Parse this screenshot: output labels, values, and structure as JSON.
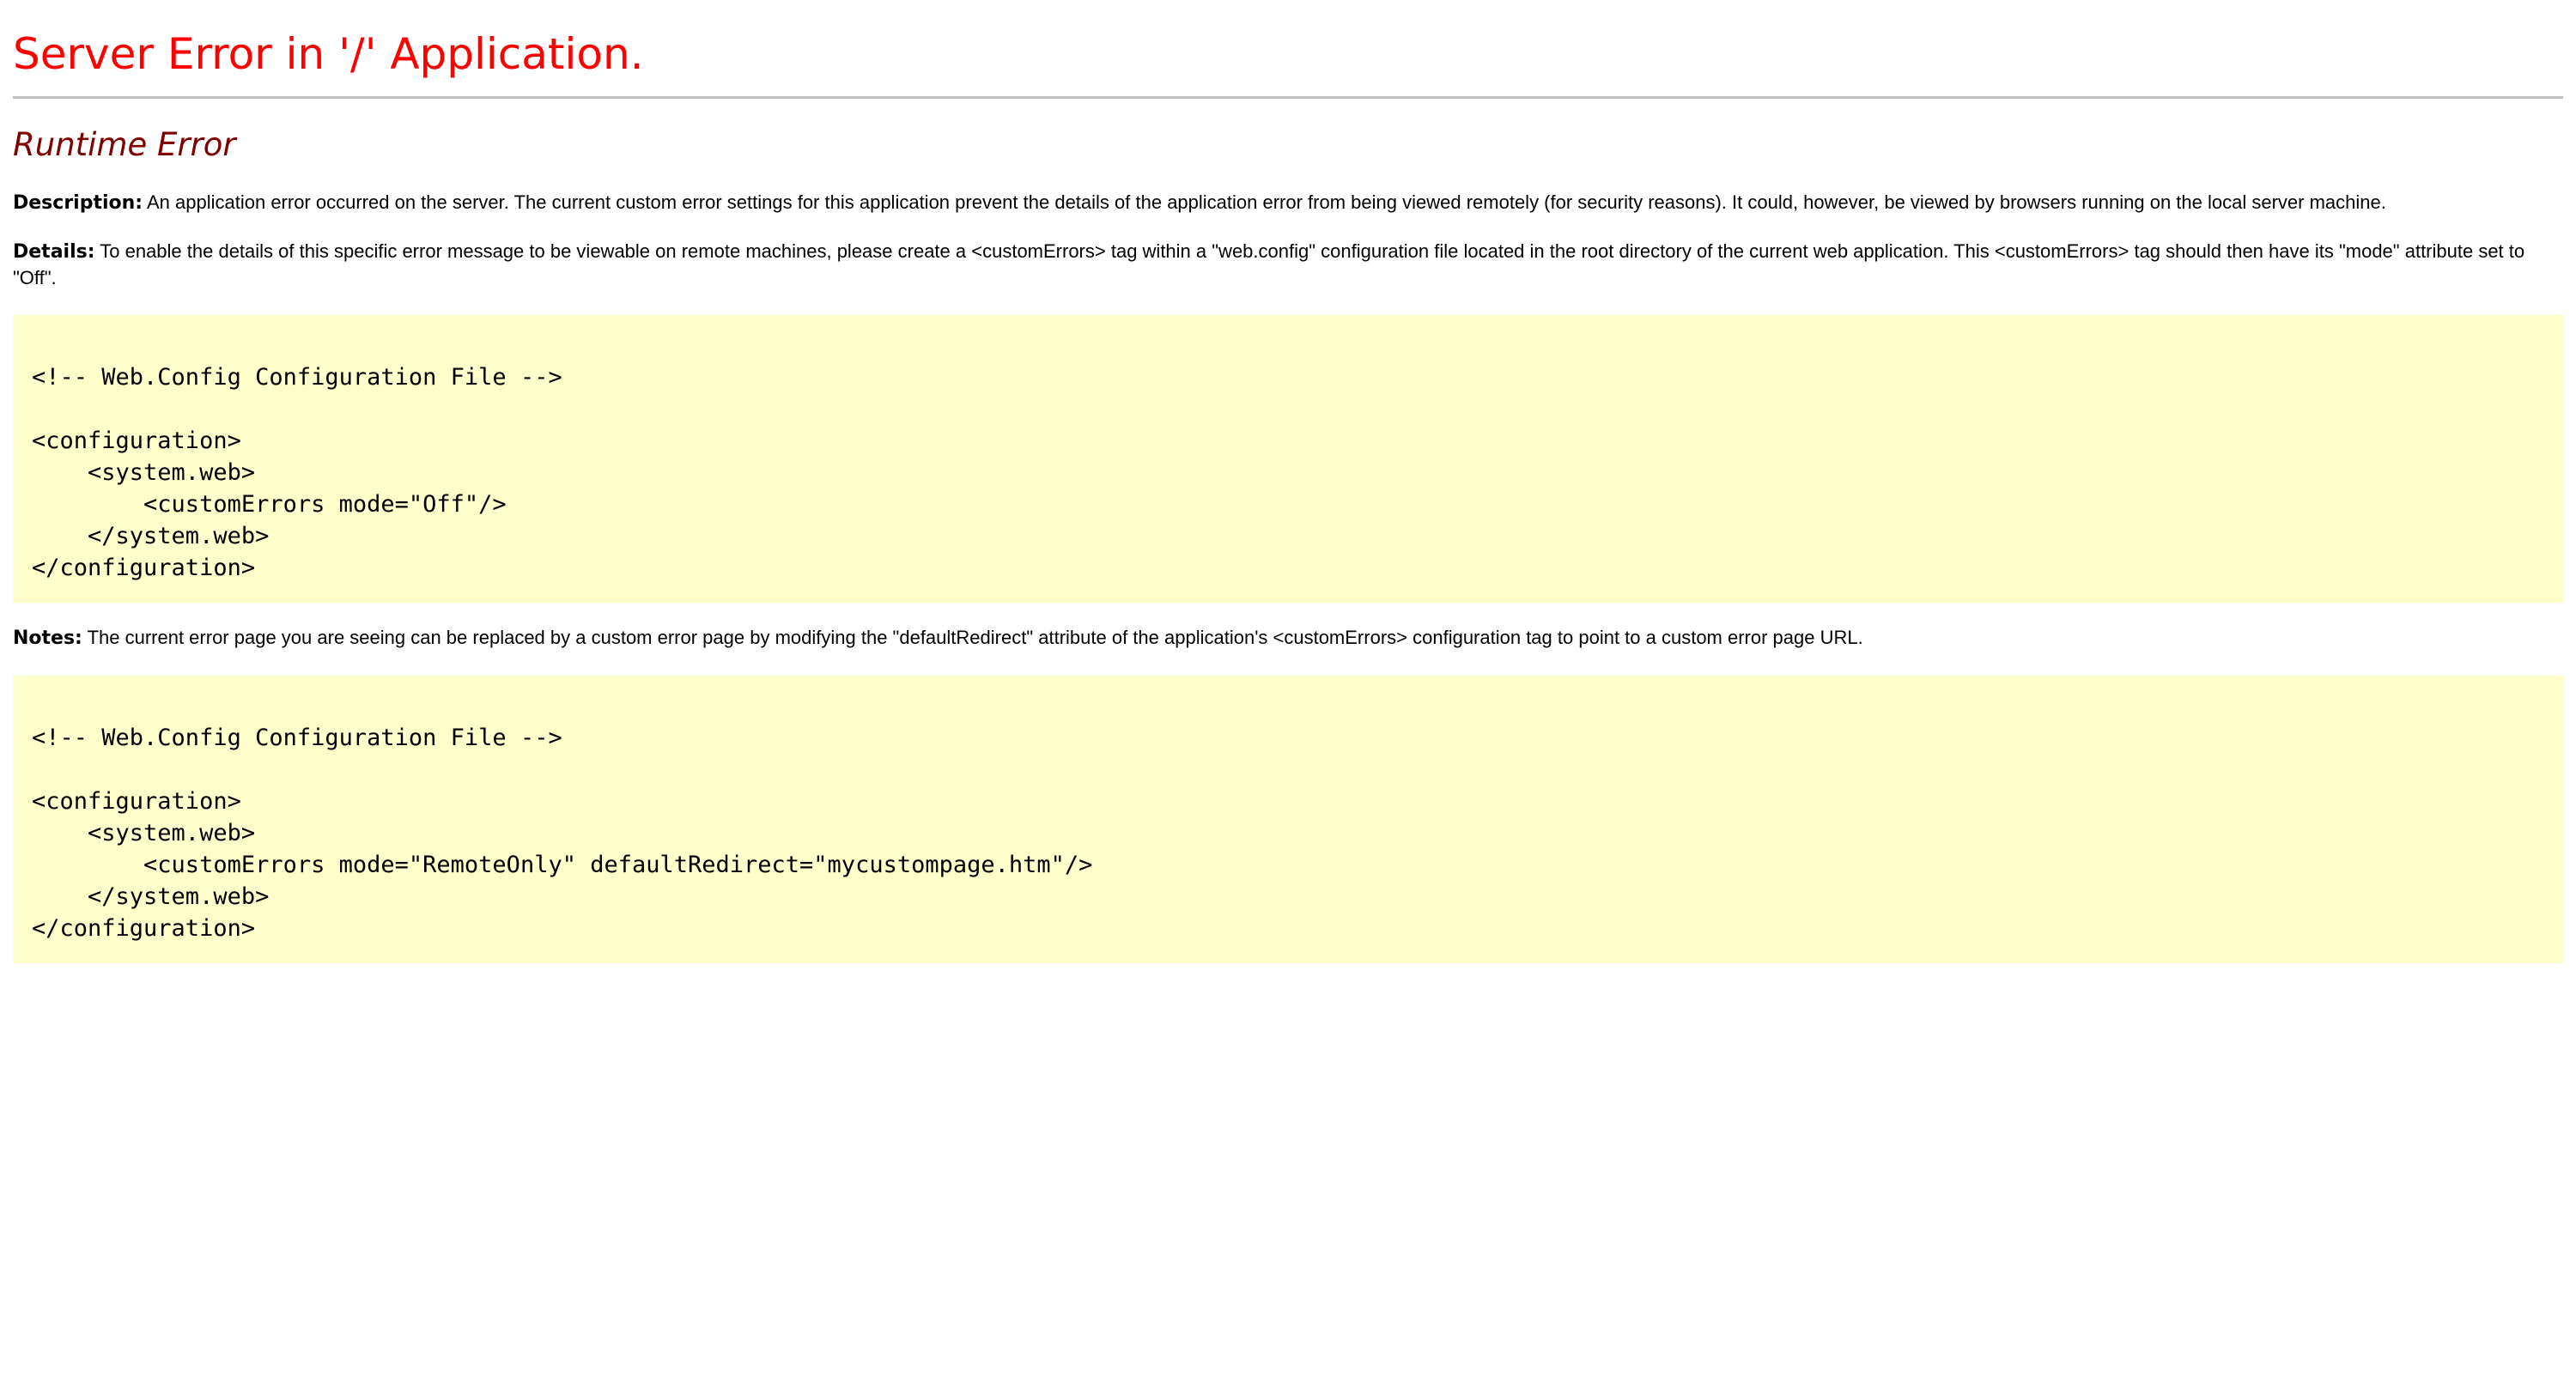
{
  "page": {
    "title": "Server Error in '/' Application.",
    "error_type": "Runtime Error"
  },
  "description": {
    "label": "Description:",
    "text": " An application error occurred on the server. The current custom error settings for this application prevent the details of the application error from being viewed remotely (for security reasons). It could, however, be viewed by browsers running on the local server machine."
  },
  "details": {
    "label": "Details:",
    "text": " To enable the details of this specific error message to be viewable on remote machines, please create a <customErrors> tag within a \"web.config\" configuration file located in the root directory of the current web application. This <customErrors> tag should then have its \"mode\" attribute set to \"Off\"."
  },
  "code1": {
    "lines": [
      "<!-- Web.Config Configuration File -->",
      "",
      "<configuration>",
      "    <system.web>",
      "        <customErrors mode=\"Off\"/>",
      "    </system.web>",
      "</configuration>"
    ]
  },
  "notes": {
    "label": "Notes:",
    "text": " The current error page you are seeing can be replaced by a custom error page by modifying the \"defaultRedirect\" attribute of the application's <customErrors> configuration tag to point to a custom error page URL."
  },
  "code2": {
    "lines": [
      "<!-- Web.Config Configuration File -->",
      "",
      "<configuration>",
      "    <system.web>",
      "        <customErrors mode=\"RemoteOnly\" defaultRedirect=\"mycustompage.htm\"/>",
      "    </system.web>",
      "</configuration>"
    ]
  },
  "colors": {
    "title": "#ff0000",
    "heading": "#800000",
    "code_background": "#ffffcc",
    "rule": "#c0c0c0"
  }
}
